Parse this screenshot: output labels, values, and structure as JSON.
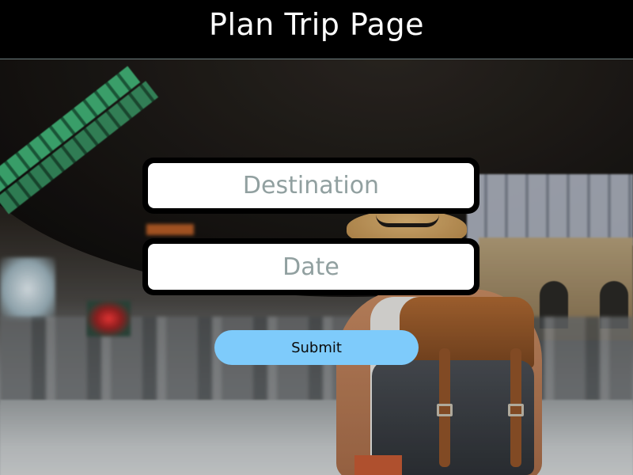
{
  "header": {
    "title": "Plan Trip Page"
  },
  "form": {
    "destination": {
      "placeholder": "Destination",
      "value": ""
    },
    "date": {
      "placeholder": "Date",
      "value": ""
    },
    "submit_label": "Submit"
  },
  "colors": {
    "header_bg": "#000000",
    "title_text": "#ffffff",
    "field_border": "#000000",
    "placeholder_text": "#91a0a0",
    "submit_bg": "#7ecbfb",
    "submit_text": "#0b0b0b"
  }
}
